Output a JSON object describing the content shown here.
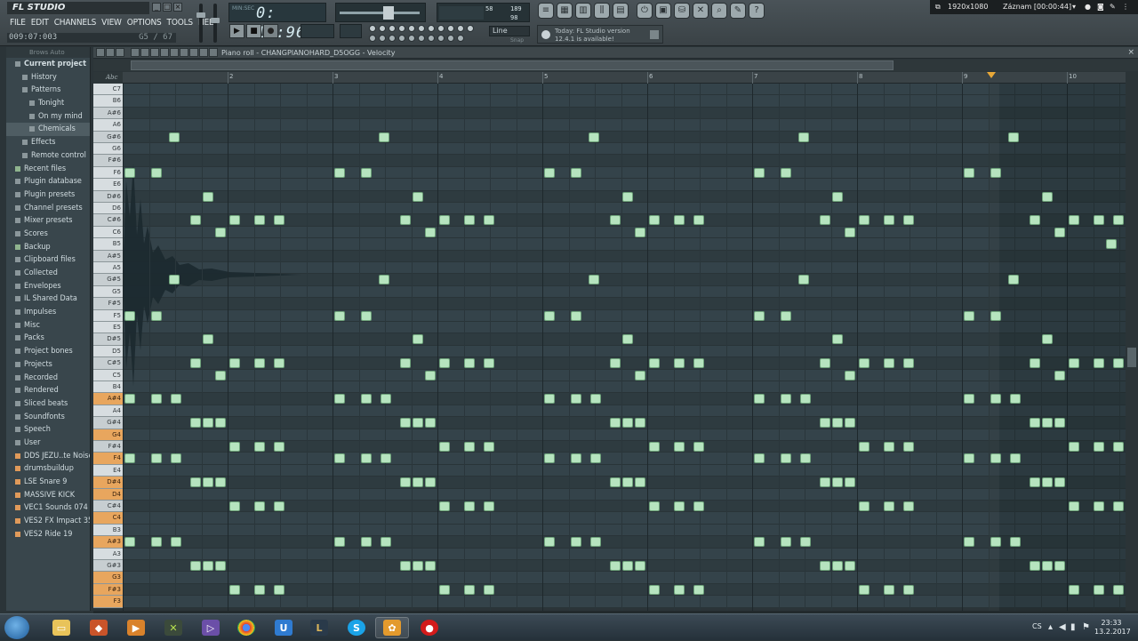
{
  "app": {
    "logo": "FL STUDIO",
    "menu": [
      "FILE",
      "EDIT",
      "CHANNELS",
      "VIEW",
      "OPTIONS",
      "TOOLS",
      "HELP"
    ],
    "hint_left": "009:07:003",
    "hint_right": "G5 / 67",
    "time_label_top": "MIN:SEC",
    "time_display": "0: 15:96",
    "pattern_display": "",
    "tempo_display": "",
    "cpu_value": "58",
    "cpu_mem": "189",
    "cpu_poly": "98",
    "snap_value": "Line",
    "snap_hint": "Snap",
    "news_line1": "Today: FL Studio version",
    "news_line2": "12.4.1 is available!",
    "recorder_resolution": "1920x1080",
    "recorder_status": "Záznam [00:00:44]"
  },
  "browser": {
    "header": "Brows  Auto",
    "items": [
      {
        "label": "Current project",
        "type": "bold",
        "indent": 0
      },
      {
        "label": "History",
        "type": "normal",
        "indent": 1
      },
      {
        "label": "Patterns",
        "type": "normal",
        "indent": 1
      },
      {
        "label": "Tonight",
        "type": "normal",
        "indent": 2
      },
      {
        "label": "On my mind",
        "type": "normal",
        "indent": 2
      },
      {
        "label": "Chemicals",
        "type": "selected",
        "indent": 2
      },
      {
        "label": "Effects",
        "type": "normal",
        "indent": 1
      },
      {
        "label": "Remote control",
        "type": "normal",
        "indent": 1
      },
      {
        "label": "Recent files",
        "type": "green",
        "indent": 0
      },
      {
        "label": "Plugin database",
        "type": "normal",
        "indent": 0
      },
      {
        "label": "Plugin presets",
        "type": "normal",
        "indent": 0
      },
      {
        "label": "Channel presets",
        "type": "normal",
        "indent": 0
      },
      {
        "label": "Mixer presets",
        "type": "normal",
        "indent": 0
      },
      {
        "label": "Scores",
        "type": "normal",
        "indent": 0
      },
      {
        "label": "Backup",
        "type": "green",
        "indent": 0
      },
      {
        "label": "Clipboard files",
        "type": "normal",
        "indent": 0
      },
      {
        "label": "Collected",
        "type": "normal",
        "indent": 0
      },
      {
        "label": "Envelopes",
        "type": "normal",
        "indent": 0
      },
      {
        "label": "IL Shared Data",
        "type": "normal",
        "indent": 0
      },
      {
        "label": "Impulses",
        "type": "normal",
        "indent": 0
      },
      {
        "label": "Misc",
        "type": "normal",
        "indent": 0
      },
      {
        "label": "Packs",
        "type": "normal",
        "indent": 0
      },
      {
        "label": "Project bones",
        "type": "normal",
        "indent": 0
      },
      {
        "label": "Projects",
        "type": "normal",
        "indent": 0
      },
      {
        "label": "Recorded",
        "type": "normal",
        "indent": 0
      },
      {
        "label": "Rendered",
        "type": "normal",
        "indent": 0
      },
      {
        "label": "Sliced beats",
        "type": "normal",
        "indent": 0
      },
      {
        "label": "Soundfonts",
        "type": "normal",
        "indent": 0
      },
      {
        "label": "Speech",
        "type": "normal",
        "indent": 0
      },
      {
        "label": "User",
        "type": "normal",
        "indent": 0
      },
      {
        "label": "DDS JEZU..te Noise 1",
        "type": "orange",
        "indent": 0
      },
      {
        "label": "drumsbuildup",
        "type": "orange",
        "indent": 0
      },
      {
        "label": "LSE Snare 9",
        "type": "orange",
        "indent": 0
      },
      {
        "label": "MASSIVE KICK",
        "type": "orange",
        "indent": 0
      },
      {
        "label": "VEC1 Sounds 074 E",
        "type": "orange",
        "indent": 0
      },
      {
        "label": "VES2 FX Impact 35",
        "type": "orange",
        "indent": 0
      },
      {
        "label": "VES2 Ride 19",
        "type": "orange",
        "indent": 0
      }
    ]
  },
  "piano_roll": {
    "title": "Piano roll - CHANGPIANOHARD_D5OGG",
    "target": "Velocity",
    "key_header": "Abc",
    "ruler": [
      "2",
      "3",
      "4",
      "5",
      "6",
      "7",
      "8",
      "9",
      "10"
    ],
    "keys": [
      {
        "label": "C7",
        "black": false,
        "hl": false
      },
      {
        "label": "B6",
        "black": false,
        "hl": false
      },
      {
        "label": "A#6",
        "black": true,
        "hl": false
      },
      {
        "label": "A6",
        "black": false,
        "hl": false
      },
      {
        "label": "G#6",
        "black": true,
        "hl": false
      },
      {
        "label": "G6",
        "black": false,
        "hl": false
      },
      {
        "label": "F#6",
        "black": true,
        "hl": false
      },
      {
        "label": "F6",
        "black": false,
        "hl": false
      },
      {
        "label": "E6",
        "black": false,
        "hl": false
      },
      {
        "label": "D#6",
        "black": true,
        "hl": false
      },
      {
        "label": "D6",
        "black": false,
        "hl": false
      },
      {
        "label": "C#6",
        "black": true,
        "hl": false
      },
      {
        "label": "C6",
        "black": false,
        "hl": false
      },
      {
        "label": "B5",
        "black": false,
        "hl": false
      },
      {
        "label": "A#5",
        "black": true,
        "hl": false
      },
      {
        "label": "A5",
        "black": false,
        "hl": false
      },
      {
        "label": "G#5",
        "black": true,
        "hl": false
      },
      {
        "label": "G5",
        "black": false,
        "hl": false
      },
      {
        "label": "F#5",
        "black": true,
        "hl": false
      },
      {
        "label": "F5",
        "black": false,
        "hl": false
      },
      {
        "label": "E5",
        "black": false,
        "hl": false
      },
      {
        "label": "D#5",
        "black": true,
        "hl": false
      },
      {
        "label": "D5",
        "black": false,
        "hl": false
      },
      {
        "label": "C#5",
        "black": true,
        "hl": false
      },
      {
        "label": "C5",
        "black": false,
        "hl": false
      },
      {
        "label": "B4",
        "black": false,
        "hl": false
      },
      {
        "label": "A#4",
        "black": true,
        "hl": true
      },
      {
        "label": "A4",
        "black": false,
        "hl": false
      },
      {
        "label": "G#4",
        "black": true,
        "hl": false
      },
      {
        "label": "G4",
        "black": false,
        "hl": true
      },
      {
        "label": "F#4",
        "black": true,
        "hl": false
      },
      {
        "label": "F4",
        "black": false,
        "hl": true
      },
      {
        "label": "E4",
        "black": false,
        "hl": false
      },
      {
        "label": "D#4",
        "black": true,
        "hl": true
      },
      {
        "label": "D4",
        "black": false,
        "hl": true
      },
      {
        "label": "C#4",
        "black": true,
        "hl": false
      },
      {
        "label": "C4",
        "black": false,
        "hl": true
      },
      {
        "label": "B3",
        "black": false,
        "hl": false
      },
      {
        "label": "A#3",
        "black": true,
        "hl": true
      },
      {
        "label": "A3",
        "black": false,
        "hl": false
      },
      {
        "label": "G#3",
        "black": true,
        "hl": false
      },
      {
        "label": "G3",
        "black": false,
        "hl": true
      },
      {
        "label": "F#3",
        "black": true,
        "hl": true
      },
      {
        "label": "F3",
        "black": false,
        "hl": true
      }
    ]
  },
  "taskbar": {
    "language": "CS",
    "time": "23:33",
    "date": "13.2.2017"
  }
}
